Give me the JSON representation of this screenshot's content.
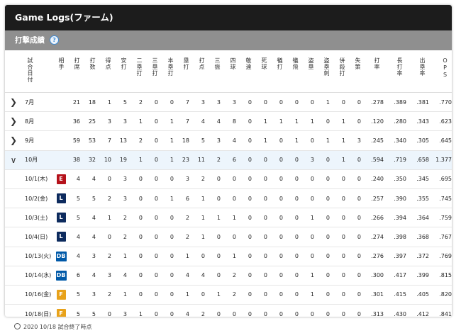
{
  "header": {
    "title": "Game Logs(ファーム)"
  },
  "section": {
    "title": "打撃成績",
    "help_icon": "?"
  },
  "columns": [
    "試合日付",
    "相手",
    "打席",
    "打数",
    "得点",
    "安打",
    "二塁打",
    "三塁打",
    "本塁打",
    "塁打",
    "打点",
    "三振",
    "四球",
    "敬遠",
    "死球",
    "犠打",
    "犠飛",
    "盗塁",
    "盗塁刺",
    "併殺打",
    "失策",
    "打率",
    "長打率",
    "出塁率",
    "OPS"
  ],
  "rows": [
    {
      "date": "7月",
      "expand": "collapsed",
      "team": "",
      "stats": [
        "21",
        "18",
        "1",
        "5",
        "2",
        "0",
        "0",
        "7",
        "3",
        "3",
        "3",
        "0",
        "0",
        "0",
        "0",
        "0",
        "1",
        "0",
        "0",
        ".278",
        ".389",
        ".381",
        ".770"
      ]
    },
    {
      "date": "8月",
      "expand": "collapsed",
      "team": "",
      "stats": [
        "36",
        "25",
        "3",
        "3",
        "1",
        "0",
        "1",
        "7",
        "4",
        "4",
        "8",
        "0",
        "1",
        "1",
        "1",
        "1",
        "0",
        "1",
        "0",
        ".120",
        ".280",
        ".343",
        ".623"
      ]
    },
    {
      "date": "9月",
      "expand": "collapsed",
      "team": "",
      "stats": [
        "59",
        "53",
        "7",
        "13",
        "2",
        "0",
        "1",
        "18",
        "5",
        "3",
        "4",
        "0",
        "1",
        "0",
        "1",
        "0",
        "1",
        "1",
        "3",
        ".245",
        ".340",
        ".305",
        ".645"
      ]
    },
    {
      "date": "10月",
      "expand": "expanded",
      "team": "",
      "stats": [
        "38",
        "32",
        "10",
        "19",
        "1",
        "0",
        "1",
        "23",
        "11",
        "2",
        "6",
        "0",
        "0",
        "0",
        "0",
        "3",
        "0",
        "1",
        "0",
        ".594",
        ".719",
        ".658",
        "1.377"
      ]
    },
    {
      "date": "10/1(木)",
      "expand": "none",
      "team": "E",
      "team_color": "#b5121b",
      "stats": [
        "4",
        "4",
        "0",
        "3",
        "0",
        "0",
        "0",
        "3",
        "2",
        "0",
        "0",
        "0",
        "0",
        "0",
        "0",
        "0",
        "0",
        "0",
        "0",
        ".240",
        ".350",
        ".345",
        ".695"
      ]
    },
    {
      "date": "10/2(金)",
      "expand": "none",
      "team": "L",
      "team_color": "#0d2b5e",
      "stats": [
        "5",
        "5",
        "2",
        "3",
        "0",
        "0",
        "1",
        "6",
        "1",
        "0",
        "0",
        "0",
        "0",
        "0",
        "0",
        "0",
        "0",
        "0",
        "0",
        ".257",
        ".390",
        ".355",
        ".745"
      ]
    },
    {
      "date": "10/3(土)",
      "expand": "none",
      "team": "L",
      "team_color": "#0d2b5e",
      "stats": [
        "5",
        "4",
        "1",
        "2",
        "0",
        "0",
        "0",
        "2",
        "1",
        "1",
        "1",
        "0",
        "0",
        "0",
        "0",
        "1",
        "0",
        "0",
        "0",
        ".266",
        ".394",
        ".364",
        ".759"
      ]
    },
    {
      "date": "10/4(日)",
      "expand": "none",
      "team": "L",
      "team_color": "#0d2b5e",
      "stats": [
        "4",
        "4",
        "0",
        "2",
        "0",
        "0",
        "0",
        "2",
        "1",
        "0",
        "0",
        "0",
        "0",
        "0",
        "0",
        "0",
        "0",
        "0",
        "0",
        ".274",
        ".398",
        ".368",
        ".767"
      ]
    },
    {
      "date": "10/13(火)",
      "expand": "none",
      "team": "DB",
      "team_color": "#0059a8",
      "stats": [
        "4",
        "3",
        "2",
        "1",
        "0",
        "0",
        "0",
        "1",
        "0",
        "0",
        "1",
        "0",
        "0",
        "0",
        "0",
        "0",
        "0",
        "0",
        "0",
        ".276",
        ".397",
        ".372",
        ".769"
      ]
    },
    {
      "date": "10/14(水)",
      "expand": "none",
      "team": "DB",
      "team_color": "#0059a8",
      "stats": [
        "6",
        "4",
        "3",
        "4",
        "0",
        "0",
        "0",
        "4",
        "4",
        "0",
        "2",
        "0",
        "0",
        "0",
        "0",
        "1",
        "0",
        "0",
        "0",
        ".300",
        ".417",
        ".399",
        ".815"
      ]
    },
    {
      "date": "10/16(金)",
      "expand": "none",
      "team": "F",
      "team_color": "#e8a21a",
      "stats": [
        "5",
        "3",
        "2",
        "1",
        "0",
        "0",
        "0",
        "1",
        "0",
        "1",
        "2",
        "0",
        "0",
        "0",
        "0",
        "1",
        "0",
        "0",
        "0",
        ".301",
        ".415",
        ".405",
        ".820"
      ]
    },
    {
      "date": "10/18(日)",
      "expand": "none",
      "team": "F",
      "team_color": "#e8a21a",
      "stats": [
        "5",
        "5",
        "0",
        "3",
        "1",
        "0",
        "0",
        "4",
        "2",
        "0",
        "0",
        "0",
        "0",
        "0",
        "0",
        "0",
        "0",
        "0",
        "0",
        ".313",
        ".430",
        ".412",
        ".841"
      ]
    }
  ],
  "footer": {
    "note": "2020 10/18 試合終了時点"
  }
}
